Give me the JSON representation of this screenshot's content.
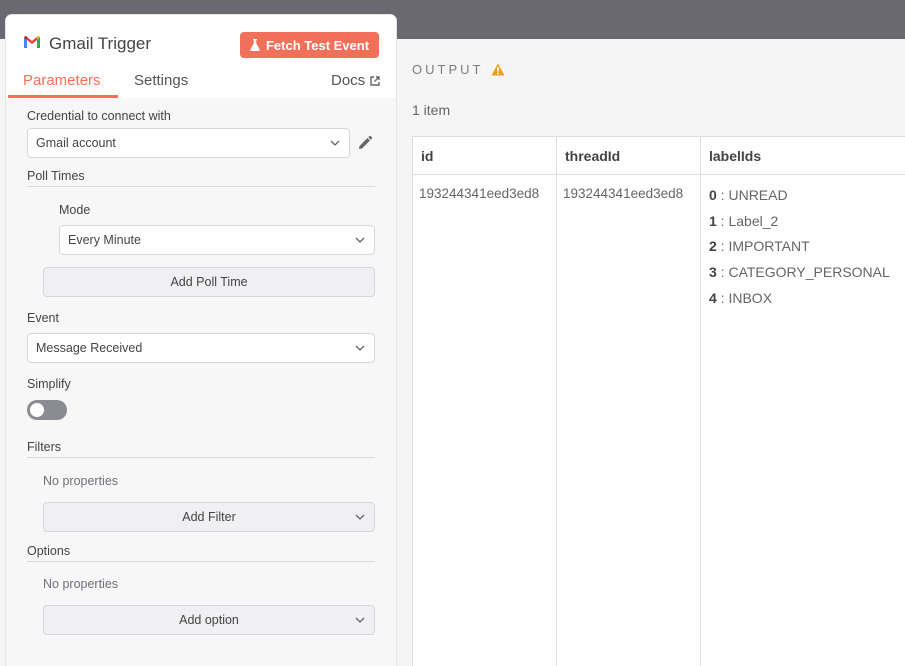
{
  "node": {
    "title": "Gmail Trigger",
    "fetch_button": "Fetch Test Event",
    "tabs": [
      "Parameters",
      "Settings"
    ],
    "docs_label": "Docs"
  },
  "params": {
    "credential_label": "Credential to connect with",
    "credential_value": "Gmail account",
    "poll_times_title": "Poll Times",
    "mode_label": "Mode",
    "mode_value": "Every Minute",
    "add_poll_time": "Add Poll Time",
    "event_label": "Event",
    "event_value": "Message Received",
    "simplify_label": "Simplify",
    "simplify_on": false,
    "filters_title": "Filters",
    "filters_empty": "No properties",
    "add_filter": "Add Filter",
    "options_title": "Options",
    "options_empty": "No properties",
    "add_option": "Add option"
  },
  "output": {
    "title": "OUTPUT",
    "item_count": "1 item",
    "columns": [
      "id",
      "threadId",
      "labelIds"
    ],
    "row": {
      "id": "193244341eed3ed8",
      "threadId": "193244341eed3ed8",
      "labelIds": [
        {
          "index": "0",
          "value": "UNREAD"
        },
        {
          "index": "1",
          "value": "Label_2"
        },
        {
          "index": "2",
          "value": "IMPORTANT"
        },
        {
          "index": "3",
          "value": "CATEGORY_PERSONAL"
        },
        {
          "index": "4",
          "value": "INBOX"
        }
      ]
    }
  },
  "colors": {
    "accent": "#ff6d5a",
    "fetch_button_bg": "#f0705a",
    "topbar": "#6a6972",
    "warning": "#f0a020"
  }
}
